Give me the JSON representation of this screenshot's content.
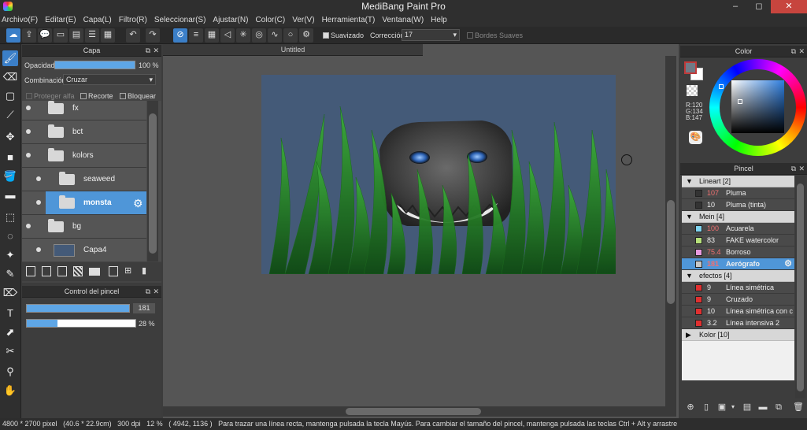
{
  "window": {
    "title": "MediBang Paint Pro",
    "minimize": "–",
    "maximize": "◻",
    "close": "✕"
  },
  "menu": [
    "Archivo(F)",
    "Editar(E)",
    "Capa(L)",
    "Filtro(R)",
    "Seleccionar(S)",
    "Ajustar(N)",
    "Color(C)",
    "Ver(V)",
    "Herramienta(T)",
    "Ventana(W)",
    "Help"
  ],
  "toolbar": {
    "suavizado_label": "Suavizado",
    "correccion_label": "Corrección",
    "correccion_value": "17",
    "bordes_label": "Bordes Suaves"
  },
  "layer_panel": {
    "title": "Capa",
    "opacity_label": "Opacidad",
    "opacity_value": "100 %",
    "opacity_fraction": 1.0,
    "blend_label": "Combinación",
    "blend_value": "Cruzar",
    "protect_alpha": "Proteger alfa",
    "clip": "Recorte",
    "lock": "Bloquear",
    "layers": [
      {
        "name": "fx",
        "type": "folder",
        "indent": 0,
        "selected": false
      },
      {
        "name": "bct",
        "type": "folder",
        "indent": 0,
        "selected": false
      },
      {
        "name": "kolors",
        "type": "folder",
        "indent": 0,
        "selected": false
      },
      {
        "name": "seaweed",
        "type": "folder",
        "indent": 1,
        "selected": false
      },
      {
        "name": "monsta",
        "type": "folder",
        "indent": 1,
        "selected": true
      },
      {
        "name": "bg",
        "type": "folder",
        "indent": 0,
        "selected": false
      },
      {
        "name": "Capa4",
        "type": "layer",
        "indent": 1,
        "selected": false
      }
    ]
  },
  "brush_control": {
    "title": "Control del pincel",
    "size_value": "181",
    "opacity_value": "28 %",
    "size_fraction": 1.0,
    "opacity_fraction": 0.28
  },
  "document": {
    "tab": "Untitled"
  },
  "color_panel": {
    "title": "Color",
    "r_label": "R:120",
    "g_label": "G:134",
    "b_label": "B:147",
    "fg_color": "#c03a3a",
    "bg_color": "#ffffff"
  },
  "brush_panel": {
    "title": "Pincel",
    "groups": [
      {
        "name": "Lineart [2]",
        "expanded": true,
        "items": [
          {
            "size": "107",
            "name": "Pluma",
            "color": "#333333",
            "red": true,
            "selected": false
          },
          {
            "size": "10",
            "name": "Pluma (tinta)",
            "color": "#333333",
            "red": false,
            "selected": false
          }
        ]
      },
      {
        "name": "Mein [4]",
        "expanded": true,
        "items": [
          {
            "size": "100",
            "name": "Acuarela",
            "color": "#7fd4f0",
            "red": true,
            "selected": false
          },
          {
            "size": "83",
            "name": "FAKE watercolor",
            "color": "#b6e07a",
            "red": false,
            "selected": false
          },
          {
            "size": "75.4",
            "name": "Borroso",
            "color": "#e89ae0",
            "red": true,
            "selected": false
          },
          {
            "size": "181",
            "name": "Aerógrafo",
            "color": "#c8c8c8",
            "red": true,
            "selected": true
          }
        ]
      },
      {
        "name": "efectos [4]",
        "expanded": true,
        "items": [
          {
            "size": "9",
            "name": "Línea simétrica",
            "color": "#e03030",
            "red": false,
            "selected": false
          },
          {
            "size": "9",
            "name": "Cruzado",
            "color": "#e03030",
            "red": false,
            "selected": false
          },
          {
            "size": "10",
            "name": "Línea simétrica con c",
            "color": "#e03030",
            "red": false,
            "selected": false
          },
          {
            "size": "3.2",
            "name": "Línea intensiva 2",
            "color": "#e03030",
            "red": false,
            "selected": false
          }
        ]
      },
      {
        "name": "Kolor [10]",
        "expanded": false,
        "items": []
      }
    ]
  },
  "status": {
    "size": "4800 * 2700 pixel",
    "cm": "(40.6 * 22.9cm)",
    "dpi": "300 dpi",
    "zoom": "12 %",
    "coords": "( 4942, 1136 )",
    "hint": "Para trazar una línea recta, mantenga pulsada la tecla Mayús. Para cambiar el tamaño del pincel, mantenga pulsada las teclas Ctrl + Alt y arrastre"
  }
}
